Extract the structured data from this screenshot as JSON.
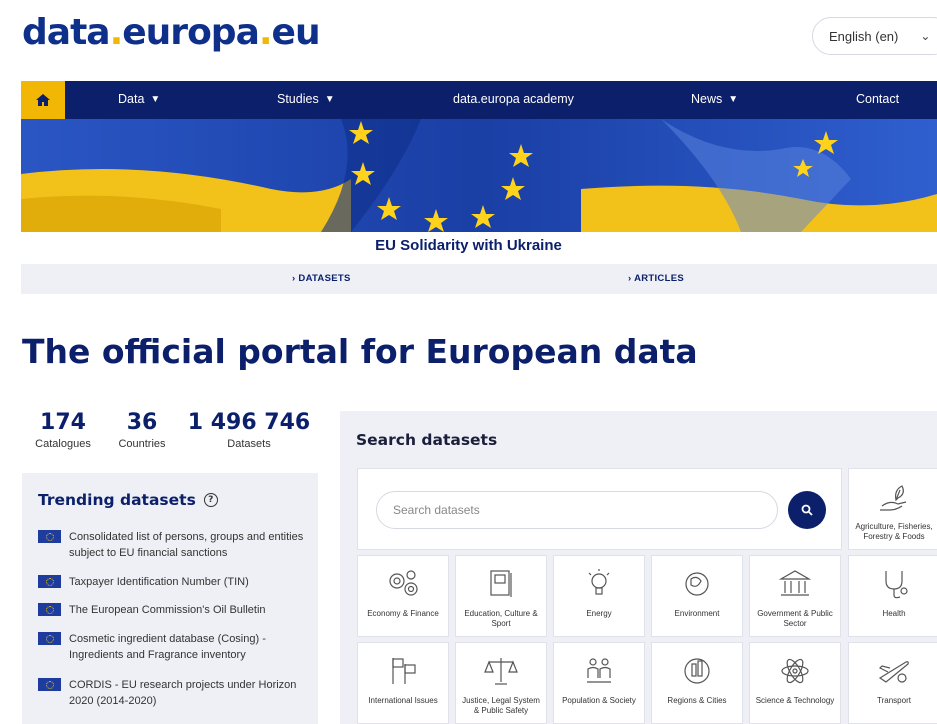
{
  "header": {
    "logo_main": "data",
    "logo_dot1": ".",
    "logo_mid": "europa",
    "logo_dot2": ".",
    "logo_tail": "eu",
    "language": "English (en)"
  },
  "nav": {
    "items": [
      {
        "label": "Data"
      },
      {
        "label": "Studies"
      },
      {
        "label": "data.europa academy"
      },
      {
        "label": "News"
      },
      {
        "label": "Contact"
      }
    ]
  },
  "banner": {
    "caption": "EU Solidarity with Ukraine",
    "links": [
      "DATASETS",
      "ARTICLES"
    ]
  },
  "page_title": "The official portal for European data",
  "stats": [
    {
      "value": "174",
      "label": "Catalogues"
    },
    {
      "value": "36",
      "label": "Countries"
    },
    {
      "value": "1 496 746",
      "label": "Datasets"
    }
  ],
  "trending": {
    "title": "Trending datasets",
    "items": [
      "Consolidated list of persons, groups and entities subject to EU financial sanctions",
      "Taxpayer Identification Number (TIN)",
      "The European Commission's Oil Bulletin",
      "Cosmetic ingredient database (Cosing) - Ingredients and Fragrance inventory",
      "CORDIS - EU research projects under Horizon 2020 (2014-2020)"
    ]
  },
  "search": {
    "title": "Search datasets",
    "placeholder": "Search datasets",
    "categories": [
      "Agriculture, Fisheries, Forestry & Foods",
      "Economy & Finance",
      "Education, Culture & Sport",
      "Energy",
      "Environment",
      "Government & Public Sector",
      "Health",
      "International Issues",
      "Justice, Legal System & Public Safety",
      "Population & Society",
      "Regions & Cities",
      "Science & Technology",
      "Transport"
    ]
  },
  "colors": {
    "navy": "#0b1f6b",
    "yellow": "#f2b705",
    "panel": "#eef0f5"
  }
}
